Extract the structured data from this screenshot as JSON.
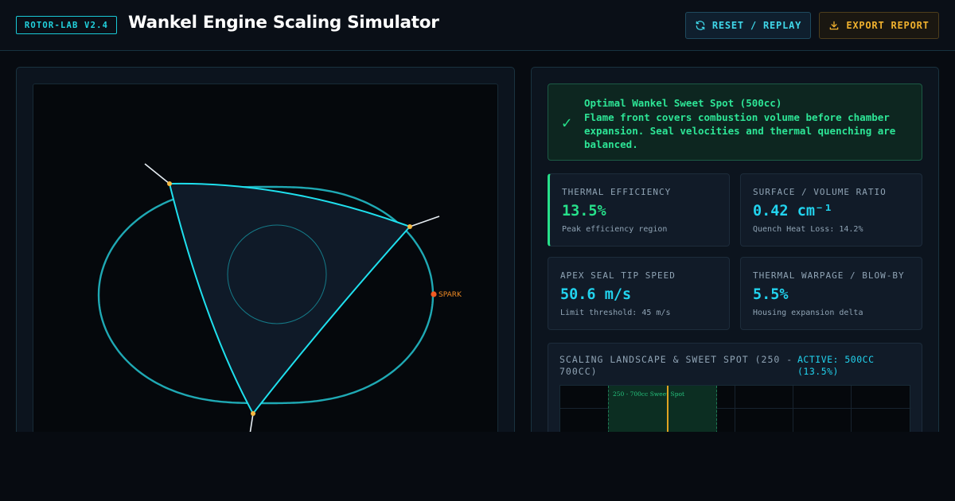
{
  "header": {
    "badge": "ROTOR-LAB V2.4",
    "title": "Wankel Engine Scaling Simulator",
    "reset_label": "RESET / REPLAY",
    "export_label": "EXPORT REPORT"
  },
  "simulation": {
    "spark_label": "SPARK",
    "colors": {
      "housing": "#1fa9b4",
      "rotor": "#1fe0ee",
      "apex": "#f5b942",
      "spark": "#f05a22"
    }
  },
  "status": {
    "title": "Optimal Wankel Sweet Spot (500cc)",
    "description": "Flame front covers combustion volume before chamber expansion. Seal velocities and thermal quenching are balanced."
  },
  "metrics": [
    {
      "label": "THERMAL EFFICIENCY",
      "value": "13.5%",
      "sub": "Peak efficiency region"
    },
    {
      "label": "SURFACE / VOLUME RATIO",
      "value": "0.42 cm⁻¹",
      "sub": "Quench Heat Loss: 14.2%"
    },
    {
      "label": "APEX SEAL TIP SPEED",
      "value": "50.6 m/s",
      "sub": "Limit threshold: 45 m/s"
    },
    {
      "label": "THERMAL WARPAGE / BLOW-BY",
      "value": "5.5%",
      "sub": "Housing expansion delta"
    }
  ],
  "landscape": {
    "title": "SCALING LANDSCAPE & SWEET SPOT (250 - 700CC)",
    "active": "ACTIVE: 500CC (13.5%)",
    "sweet_label": "250 - 700cc Sweet Spot"
  }
}
